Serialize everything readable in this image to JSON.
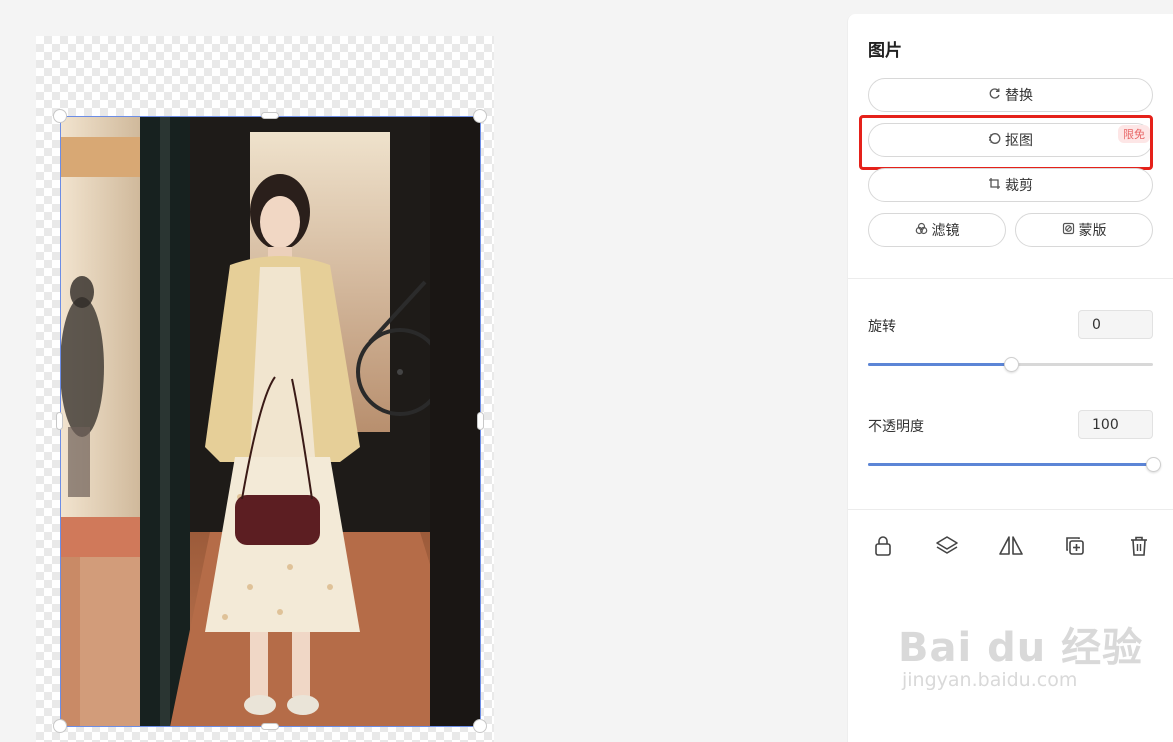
{
  "panel": {
    "title": "图片",
    "replace_label": "替换",
    "matting_label": "抠图",
    "matting_badge": "限免",
    "crop_label": "裁剪",
    "filter_label": "滤镜",
    "mask_label": "蒙版",
    "rotate_label": "旋转",
    "rotate_value": "0",
    "rotate_fraction": 0.5,
    "opacity_label": "不透明度",
    "opacity_value": "100",
    "opacity_fraction": 1.0
  },
  "toolbar_icons": [
    "lock-icon",
    "layers-icon",
    "flip-icon",
    "duplicate-icon",
    "delete-icon"
  ],
  "watermark": {
    "logo": "Bai du 经验",
    "url": "jingyan.baidu.com"
  },
  "colors": {
    "accent": "#5c85d6",
    "highlight": "#e5211a",
    "badge_text": "#e86666",
    "selection": "#6c8de6"
  }
}
